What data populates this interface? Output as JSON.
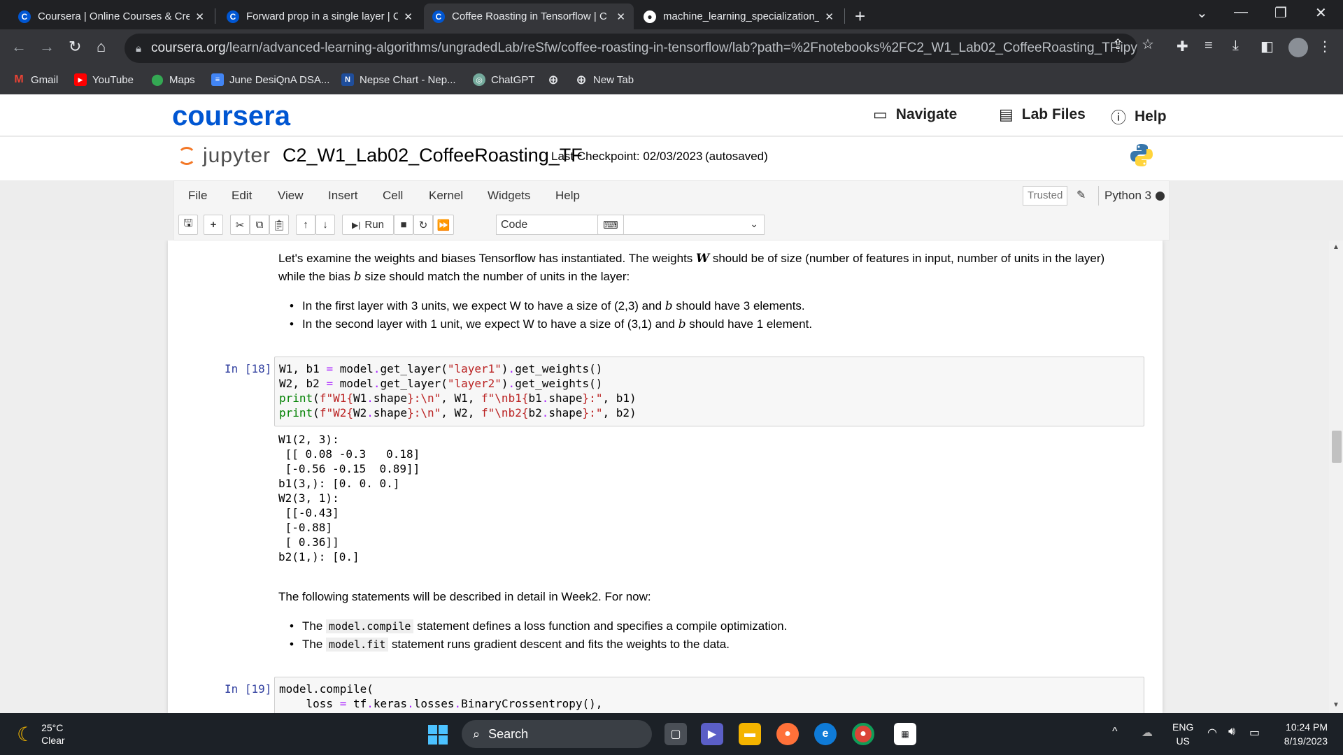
{
  "browser": {
    "tabs": [
      {
        "title": "Coursera | Online Courses & Crec",
        "favicon": "C"
      },
      {
        "title": "Forward prop in a single layer | C",
        "favicon": "C"
      },
      {
        "title": "Coffee Roasting in Tensorflow | C",
        "favicon": "C"
      },
      {
        "title": "machine_learning_specialization_",
        "favicon": "github-icon"
      }
    ],
    "url_host": "coursera.org",
    "url_path": "/learn/advanced-learning-algorithms/ungradedLab/reSfw/coffee-roasting-in-tensorflow/lab?path=%2Fnotebooks%2FC2_W1_Lab02_CoffeeRoasting_TF.ipynb",
    "bookmarks": [
      {
        "label": "Gmail",
        "color": "#ea4335",
        "glyph": "M"
      },
      {
        "label": "YouTube",
        "color": "#ff0000",
        "glyph": "▶"
      },
      {
        "label": "Maps",
        "color": "#34a853",
        "glyph": "⬤"
      },
      {
        "label": "June DesiQnA DSA...",
        "color": "#4285f4",
        "glyph": "≡"
      },
      {
        "label": "Nepse Chart - Nep...",
        "color": "#1f4e9c",
        "glyph": "N"
      },
      {
        "label": "ChatGPT",
        "color": "#74aa9c",
        "glyph": "◎"
      },
      {
        "label": "",
        "color": "#5f6368",
        "glyph": "⊕"
      },
      {
        "label": "New Tab",
        "color": "#5f6368",
        "glyph": "⊕"
      }
    ]
  },
  "coursera": {
    "logo": "coursera",
    "navigate": "Navigate",
    "lab_files": "Lab Files",
    "help": "Help"
  },
  "jupyter": {
    "logo_text": "jupyter",
    "notebook_name": "C2_W1_Lab02_CoffeeRoasting_TF",
    "checkpoint": "Last Checkpoint: 02/03/2023",
    "autosave": "(autosaved)",
    "menus": [
      "File",
      "Edit",
      "View",
      "Insert",
      "Cell",
      "Kernel",
      "Widgets",
      "Help"
    ],
    "trusted": "Trusted",
    "kernel": "Python 3",
    "run_label": "Run",
    "cell_type": "Code"
  },
  "notebook": {
    "md1_a": "Let's examine the weights and biases Tensorflow has instantiated. The weights ",
    "md1_w": "W",
    "md1_b_text": " should be of size (number of features in input, number of units in the layer)",
    "md1_c": "while the bias ",
    "md1_bvar": "b",
    "md1_d": " size should match the number of units in the layer:",
    "bullet1_a": "In the first layer with 3 units, we expect W to have a size of (2,3) and ",
    "bullet1_b": "b",
    "bullet1_c": " should have 3 elements.",
    "bullet2_a": "In the second layer with 1 unit, we expect W to have a size of (3,1) and ",
    "bullet2_b": "b",
    "bullet2_c": " should have 1 element.",
    "prompt18": "In [18]:",
    "code18": [
      "W1, b1 = model.get_layer(\"layer1\").get_weights()",
      "W2, b2 = model.get_layer(\"layer2\").get_weights()",
      "print(f\"W1{W1.shape}:\\n\", W1, f\"\\nb1{b1.shape}:\", b1)",
      "print(f\"W2{W2.shape}:\\n\", W2, f\"\\nb2{b2.shape}:\", b2)"
    ],
    "output18": [
      "W1(2, 3):",
      " [[ 0.08 -0.3   0.18]",
      " [-0.56 -0.15  0.89]]",
      "b1(3,): [0. 0. 0.]",
      "W2(3, 1):",
      " [[-0.43]",
      " [-0.88]",
      " [ 0.36]]",
      "b2(1,): [0.]"
    ],
    "md2": "The following statements will be described in detail in Week2. For now:",
    "bullet3_a": "The ",
    "bullet3_code": "model.compile",
    "bullet3_c": " statement defines a loss function and specifies a compile optimization.",
    "bullet4_a": "The ",
    "bullet4_code": "model.fit",
    "bullet4_c": " statement runs gradient descent and fits the weights to the data.",
    "prompt19": "In [19]:",
    "code19": [
      "model.compile(",
      "    loss = tf.keras.losses.BinaryCrossentropy(),"
    ]
  },
  "taskbar": {
    "temp": "25°C",
    "weather": "Clear",
    "search": "Search",
    "lang_top": "ENG",
    "lang_bottom": "US",
    "time": "10:24 PM",
    "date": "8/19/2023"
  }
}
